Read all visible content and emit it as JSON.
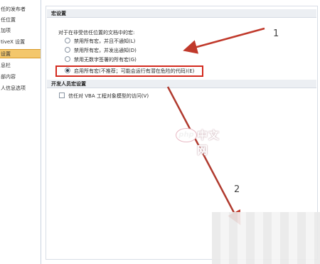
{
  "sidebar": {
    "items": [
      {
        "label": "任的发布者"
      },
      {
        "label": "任位置"
      },
      {
        "label": "加项"
      },
      {
        "label": "tiveX 设置"
      },
      {
        "label": "设置"
      },
      {
        "label": "息栏"
      },
      {
        "label": "部内容"
      },
      {
        "label": "人信息选项"
      }
    ],
    "selected_index": 4
  },
  "macro_section": {
    "title": "宏设置",
    "description": "对于在非受信任位置的文档中的宏:",
    "options": [
      {
        "label": "禁用所有宏，并且不通知(L)",
        "checked": false
      },
      {
        "label": "禁用所有宏，并发出通知(D)",
        "checked": false
      },
      {
        "label": "禁用无数字签署的所有宏(G)",
        "checked": false
      },
      {
        "label": "启用所有宏(不推荐；可能会运行有潜在危险的代码)(E)",
        "checked": true
      }
    ]
  },
  "developer_section": {
    "title": "开发人员宏设置",
    "checkbox_label": "信任对 VBA 工程对象模型的访问(V)"
  },
  "annotations": {
    "label_1": "1",
    "label_2": "2",
    "arrow_color": "#c0392b"
  },
  "watermark": {
    "logo_text": "php",
    "text": "中文网"
  }
}
